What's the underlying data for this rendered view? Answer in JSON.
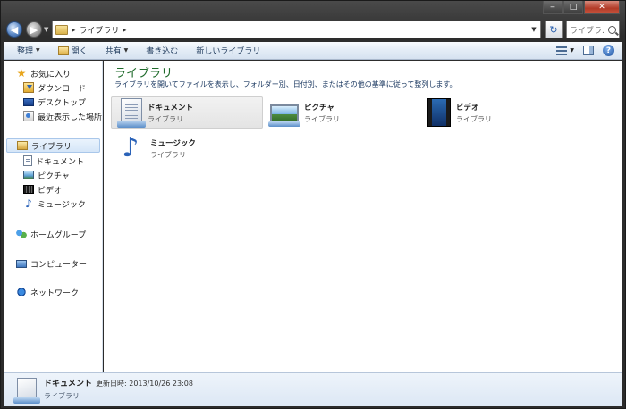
{
  "window": {
    "minimize": "‒",
    "maximize": "□",
    "close": "✕"
  },
  "address": {
    "crumb_sep": "▸",
    "path": "ライブラリ",
    "trail_sep": "▸",
    "search_placeholder": "ライブラ..."
  },
  "toolbar": {
    "organize": "整理",
    "open": "開く",
    "share": "共有",
    "burn": "書き込む",
    "new_library": "新しいライブラリ"
  },
  "sidebar": {
    "favorites": "お気に入り",
    "downloads": "ダウンロード",
    "desktop": "デスクトップ",
    "recent": "最近表示した場所",
    "libraries": "ライブラリ",
    "documents": "ドキュメント",
    "pictures": "ピクチャ",
    "videos": "ビデオ",
    "music": "ミュージック",
    "homegroup": "ホームグループ",
    "computer": "コンピューター",
    "network": "ネットワーク"
  },
  "main": {
    "title": "ライブラリ",
    "description": "ライブラリを開いてファイルを表示し、フォルダー別、日付別、またはその他の基準に従って整列します。",
    "tiles": [
      {
        "name": "ドキュメント",
        "type": "ライブラリ"
      },
      {
        "name": "ピクチャ",
        "type": "ライブラリ"
      },
      {
        "name": "ビデオ",
        "type": "ライブラリ"
      },
      {
        "name": "ミュージック",
        "type": "ライブラリ"
      }
    ]
  },
  "details": {
    "name": "ドキュメント",
    "modified": "更新日時: 2013/10/26 23:08",
    "type": "ライブラリ"
  }
}
